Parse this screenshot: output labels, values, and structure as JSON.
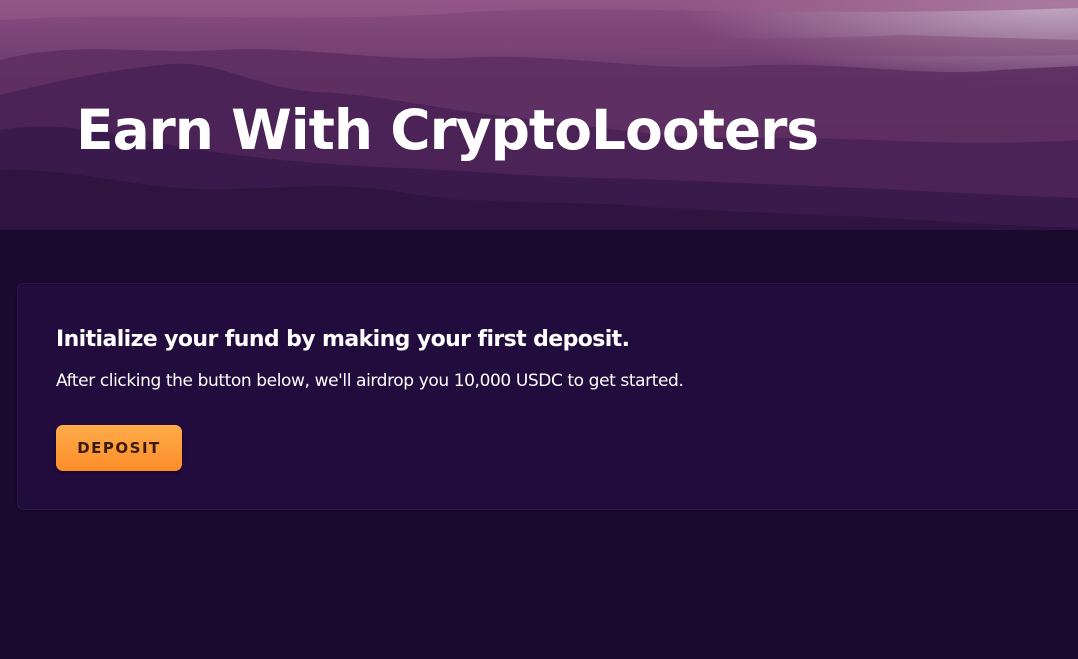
{
  "hero": {
    "title": "Earn With CryptoLooters"
  },
  "deposit_card": {
    "heading": "Initialize your fund by making your first deposit.",
    "description": "After clicking the button below, we'll airdrop you 10,000 USDC to get started.",
    "button_label": "DEPOSIT"
  },
  "colors": {
    "page_background": "#1a0a2e",
    "card_background": "#220b3d",
    "button_accent": "#fb8d2a",
    "hero_sky_top": "#8a4d80"
  }
}
